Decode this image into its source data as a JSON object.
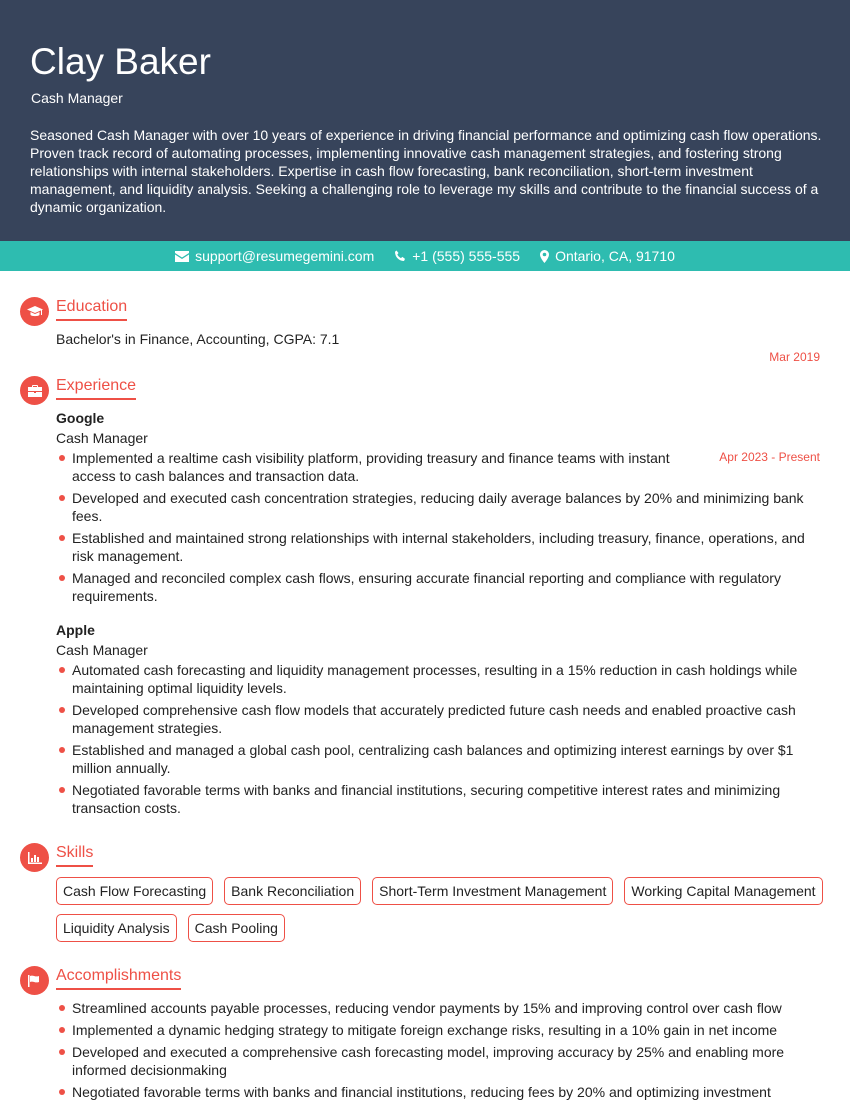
{
  "header": {
    "name": "Clay Baker",
    "title": "Cash Manager",
    "summary": "Seasoned Cash Manager with over 10 years of experience in driving financial performance and optimizing cash flow operations. Proven track record of automating processes, implementing innovative cash management strategies, and fostering strong relationships with internal stakeholders. Expertise in cash flow forecasting, bank reconciliation, short-term investment management, and liquidity analysis. Seeking a challenging role to leverage my skills and contribute to the financial success of a dynamic organization."
  },
  "contact": {
    "email": "support@resumegemini.com",
    "phone": "+1 (555) 555-555",
    "location": "Ontario, CA, 91710",
    "icons": [
      "envelope-icon",
      "phone-icon",
      "map-marker-icon"
    ]
  },
  "colors": {
    "header_bg": "#37445b",
    "contact_bg": "#2ebcb0",
    "accent": "#ee5046"
  },
  "education": {
    "heading": "Education",
    "icon": "graduation-cap-icon",
    "degree": "Bachelor's in Finance, Accounting, CGPA: 7.1",
    "date": "Mar 2019"
  },
  "experience": {
    "heading": "Experience",
    "icon": "briefcase-icon",
    "jobs": [
      {
        "company": "Google",
        "role": "Cash Manager",
        "date": "Apr 2023 - Present",
        "bullets": [
          "Implemented a realtime cash visibility platform, providing treasury and finance teams with instant access to cash balances and transaction data.",
          "Developed and executed cash concentration strategies, reducing daily average balances by 20% and minimizing bank fees.",
          "Established and maintained strong relationships with internal stakeholders, including treasury, finance, operations, and risk management.",
          "Managed and reconciled complex cash flows, ensuring accurate financial reporting and compliance with regulatory requirements."
        ]
      },
      {
        "company": "Apple",
        "role": "Cash Manager",
        "date": "",
        "bullets": [
          "Automated cash forecasting and liquidity management processes, resulting in a 15% reduction in cash holdings while maintaining optimal liquidity levels.",
          "Developed comprehensive cash flow models that accurately predicted future cash needs and enabled proactive cash management strategies.",
          "Established and managed a global cash pool, centralizing cash balances and optimizing interest earnings by over $1 million annually.",
          "Negotiated favorable terms with banks and financial institutions, securing competitive interest rates and minimizing transaction costs."
        ]
      }
    ]
  },
  "skills": {
    "heading": "Skills",
    "icon": "bar-chart-icon",
    "items": [
      "Cash Flow Forecasting",
      "Bank Reconciliation",
      "Short-Term Investment Management",
      "Working Capital Management",
      "Liquidity Analysis",
      "Cash Pooling"
    ]
  },
  "accomplishments": {
    "heading": "Accomplishments",
    "icon": "flag-icon",
    "items": [
      "Streamlined accounts payable processes, reducing vendor payments by 15% and improving control over cash flow",
      "Implemented a dynamic hedging strategy to mitigate foreign exchange risks, resulting in a 10% gain in net income",
      "Developed and executed a comprehensive cash forecasting model, improving accuracy by 25% and enabling more informed decisionmaking",
      "Negotiated favorable terms with banks and financial institutions, reducing fees by 20% and optimizing investment"
    ]
  }
}
